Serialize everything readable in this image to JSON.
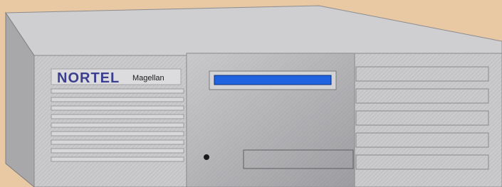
{
  "device": {
    "brand": "NORTEL",
    "model": "Magellan"
  },
  "colors": {
    "background": "#e8c9a3",
    "chassis_top": "#c7c7c9",
    "chassis_front": "#bdbdc0",
    "display_lcd": "#1f63e0",
    "brand": "#3a3f8f"
  },
  "icons": {
    "power_indicator": "led-dot-icon"
  }
}
